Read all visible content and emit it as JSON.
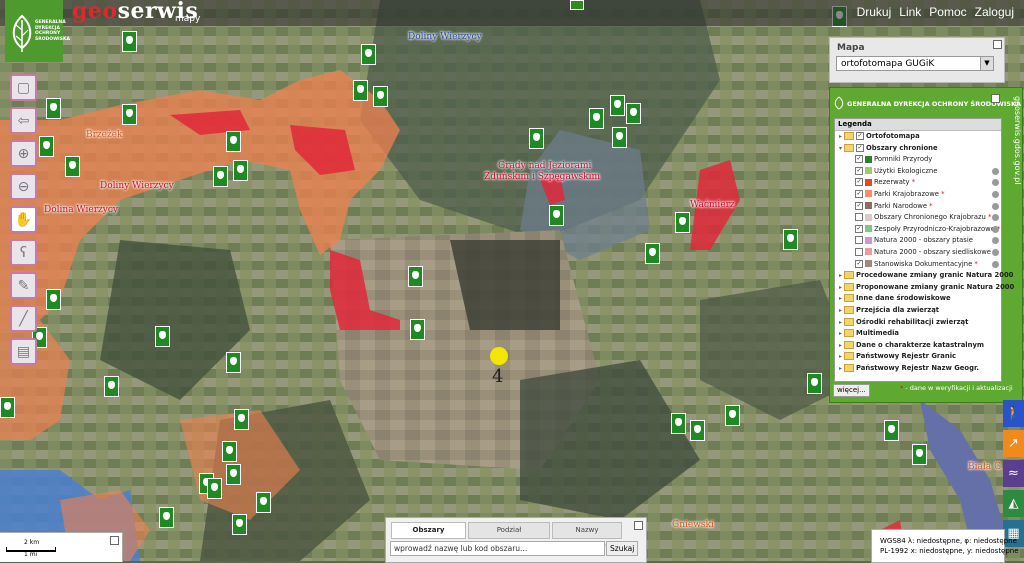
{
  "brand": {
    "geo": "geo",
    "serwis": "serwis",
    "subtitle": "mapy"
  },
  "gdos_logo": {
    "text": "GENERALNA DYREKCJA OCHRONY ŚRODOWISKA"
  },
  "topnav": [
    "Drukuj",
    "Link",
    "Pomoc",
    "Zaloguj"
  ],
  "map_panel": {
    "label": "Mapa",
    "selected": "ortofotomapa GUGiK"
  },
  "gdos_panel": {
    "header": "GENERALNA DYREKCJA OCHRONY ŚRODOWISKA",
    "side_url": "geoserwis.gdos.gov.pl"
  },
  "legend": {
    "title": "Legenda",
    "items": [
      {
        "label": "Ortofotomapa",
        "kind": "folder",
        "checked": true,
        "bold": true
      },
      {
        "label": "Obszary chronione",
        "kind": "folder",
        "checked": true,
        "bold": true,
        "expanded": true
      },
      {
        "label": "Pomniki Przyrody",
        "kind": "layer",
        "checked": true,
        "color": "#2e7d32",
        "star": false,
        "info": false
      },
      {
        "label": "Użytki Ekologiczne",
        "kind": "layer",
        "checked": true,
        "color": "#9ccc65",
        "star": false,
        "info": true
      },
      {
        "label": "Rezerwaty",
        "kind": "layer",
        "checked": true,
        "color": "#e64a19",
        "star": true,
        "info": true
      },
      {
        "label": "Parki Krajobrazowe",
        "kind": "layer",
        "checked": true,
        "color": "#ff8a65",
        "star": true,
        "info": true
      },
      {
        "label": "Parki Narodowe",
        "kind": "layer",
        "checked": true,
        "color": "#8d6e63",
        "star": true,
        "info": true
      },
      {
        "label": "Obszary Chronionego Krajobrazu",
        "kind": "layer",
        "checked": false,
        "color": "#d7ccc8",
        "star": true,
        "info": true
      },
      {
        "label": "Zespoły Przyrodniczo-Krajobrazowe",
        "kind": "layer",
        "checked": true,
        "color": "#81c784",
        "star": true,
        "info": true
      },
      {
        "label": "Natura 2000 - obszary ptasie",
        "kind": "layer",
        "checked": false,
        "color": "#ce93d8",
        "star": false,
        "info": true
      },
      {
        "label": "Natura 2000 - obszary siedliskowe",
        "kind": "layer",
        "checked": false,
        "color": "#ef9a9a",
        "star": false,
        "info": true
      },
      {
        "label": "Stanowiska Dokumentacyjne",
        "kind": "layer",
        "checked": true,
        "color": "#a1887f",
        "star": true,
        "info": true
      },
      {
        "label": "Procedowane zmiany granic Natura 2000",
        "kind": "folder",
        "checked": false,
        "bold": true
      },
      {
        "label": "Proponowane zmiany granic Natura 2000",
        "kind": "folder",
        "checked": false,
        "bold": true
      },
      {
        "label": "Inne dane środowiskowe",
        "kind": "folder",
        "checked": false,
        "bold": true
      },
      {
        "label": "Przejścia dla zwierząt",
        "kind": "folder",
        "checked": false,
        "bold": true
      },
      {
        "label": "Ośrodki rehabilitacji zwierząt",
        "kind": "folder",
        "checked": false,
        "bold": true
      },
      {
        "label": "Multimedia",
        "kind": "folder",
        "checked": false,
        "bold": true
      },
      {
        "label": "Dane o charakterze katastralnym",
        "kind": "folder",
        "checked": false,
        "bold": true
      },
      {
        "label": "Państwowy Rejestr Granic",
        "kind": "folder",
        "checked": false,
        "bold": true
      },
      {
        "label": "Państwowy Rejestr Nazw Geogr.",
        "kind": "folder",
        "checked": false,
        "bold": true
      }
    ],
    "more": "więcej...",
    "note": "- dane w weryfikacji i aktualizacji",
    "note_star": "*"
  },
  "search": {
    "tabs": [
      "Obszary chronione",
      "Podział administracyjny",
      "Nazwy geograficzne"
    ],
    "placeholder": "wprowadź nazwę lub kod obszaru...",
    "button": "Szukaj"
  },
  "scale": {
    "km": "2 km",
    "mi": "1 mi"
  },
  "coords": {
    "wgs84": "WGS84   λ: niedostępne, φ: niedostępne",
    "pl1992": "PL-1992  x: niedostępne, y: niedostępne"
  },
  "map_labels": [
    {
      "text": "Doliny Wierzycy",
      "style": "blue"
    },
    {
      "text": "Brzeżek",
      "style": "org"
    },
    {
      "text": "Doliny Wierzycy",
      "style": "red"
    },
    {
      "text": "Dolina Wierzycy",
      "style": "red"
    },
    {
      "text": "Grądy nad Jeziorami",
      "style": "red"
    },
    {
      "text": "Zduńskim i Szpęgawskim",
      "style": "red"
    },
    {
      "text": "Waćmierz",
      "style": "red"
    },
    {
      "text": "Gniewski",
      "style": "org"
    },
    {
      "text": "Biała G",
      "style": "org"
    }
  ],
  "point_label": "4",
  "colors": {
    "brand_red": "#e2262e",
    "gdos_green": "#5fa832",
    "park_orange": "#f08050",
    "reserve_red": "#e0283a"
  }
}
